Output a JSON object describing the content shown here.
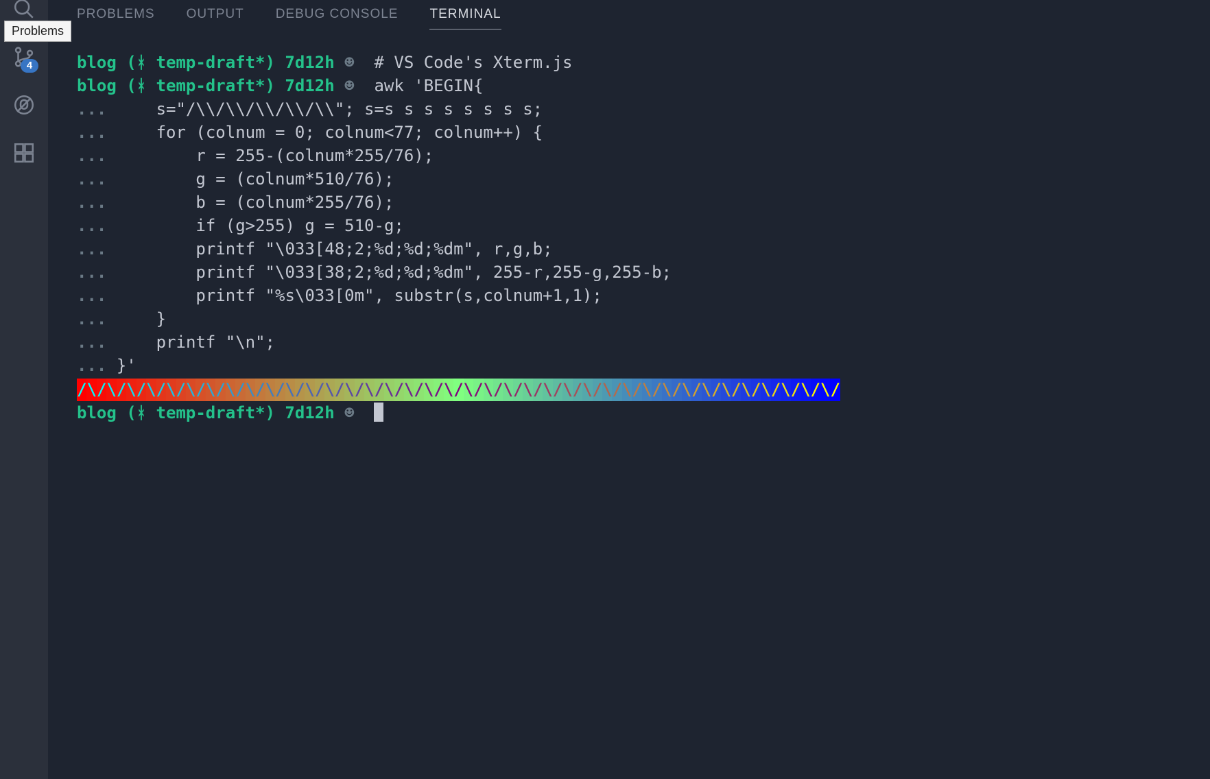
{
  "tooltip": "Problems",
  "activity": {
    "source_control_badge": "4"
  },
  "tabs": {
    "problems": "PROBLEMS",
    "output": "OUTPUT",
    "debug": "DEBUG CONSOLE",
    "terminal": "TERMINAL"
  },
  "prompt": {
    "dir": "blog",
    "branch": "temp-draft*",
    "time": "7d12h",
    "smile": "☻"
  },
  "terminal_lines": [
    {
      "type": "prompt",
      "cmd": " # VS Code's Xterm.js"
    },
    {
      "type": "prompt",
      "cmd": " awk 'BEGIN{"
    },
    {
      "type": "cont",
      "text": "    s=\"/\\\\/\\\\/\\\\/\\\\/\\\\\"; s=s s s s s s s s;"
    },
    {
      "type": "cont",
      "text": "    for (colnum = 0; colnum<77; colnum++) {"
    },
    {
      "type": "cont",
      "text": "        r = 255-(colnum*255/76);"
    },
    {
      "type": "cont",
      "text": "        g = (colnum*510/76);"
    },
    {
      "type": "cont",
      "text": "        b = (colnum*255/76);"
    },
    {
      "type": "cont",
      "text": "        if (g>255) g = 510-g;"
    },
    {
      "type": "cont",
      "text": "        printf \"\\033[48;2;%d;%d;%dm\", r,g,b;"
    },
    {
      "type": "cont",
      "text": "        printf \"\\033[38;2;%d;%d;%dm\", 255-r,255-g,255-b;"
    },
    {
      "type": "cont",
      "text": "        printf \"%s\\033[0m\", substr(s,colnum+1,1);"
    },
    {
      "type": "cont",
      "text": "    }"
    },
    {
      "type": "cont",
      "text": "    printf \"\\n\";"
    },
    {
      "type": "cont",
      "text": "}'"
    }
  ],
  "zigzag_cols": 77
}
